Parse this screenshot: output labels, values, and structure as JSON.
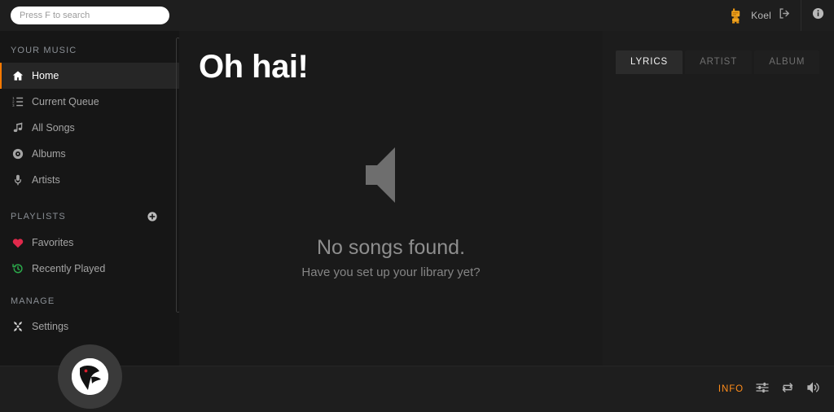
{
  "app": {
    "name": "Koel"
  },
  "topbar": {
    "search": {
      "placeholder": "Press F to search",
      "value": ""
    },
    "username": "Koel",
    "avatar_icon": "user-avatar-icon",
    "logout_icon": "logout-icon",
    "info_icon": "info-circle-icon"
  },
  "sidebar": {
    "sections": [
      {
        "heading": "YOUR MUSIC",
        "has_add_button": false,
        "items": [
          {
            "label": "Home",
            "icon": "home-icon",
            "active": true
          },
          {
            "label": "Current Queue",
            "icon": "queue-list-icon",
            "active": false
          },
          {
            "label": "All Songs",
            "icon": "music-note-icon",
            "active": false
          },
          {
            "label": "Albums",
            "icon": "compact-disc-icon",
            "active": false
          },
          {
            "label": "Artists",
            "icon": "microphone-icon",
            "active": false
          }
        ]
      },
      {
        "heading": "PLAYLISTS",
        "has_add_button": true,
        "add_button_icon": "plus-circle-icon",
        "items": [
          {
            "label": "Favorites",
            "icon": "heart-icon",
            "active": false,
            "color": "#e0294b"
          },
          {
            "label": "Recently Played",
            "icon": "history-icon",
            "active": false,
            "color": "#2ba84a"
          }
        ]
      },
      {
        "heading": "MANAGE",
        "has_add_button": false,
        "items": [
          {
            "label": "Settings",
            "icon": "wrench-icon",
            "active": false
          }
        ]
      }
    ]
  },
  "main": {
    "greeting": "Oh hai!",
    "empty_state": {
      "icon": "volume-speaker-icon",
      "title": "No songs found.",
      "subtitle": "Have you set up your library yet?"
    }
  },
  "right_panel": {
    "tabs": [
      {
        "label": "LYRICS",
        "active": true
      },
      {
        "label": "ARTIST",
        "active": false
      },
      {
        "label": "ALBUM",
        "active": false
      }
    ]
  },
  "footer": {
    "album_art_icon": "koel-logo-icon",
    "info_label": "INFO",
    "equalizer_icon": "equalizer-sliders-icon",
    "repeat_icon": "repeat-icon",
    "volume_icon": "volume-high-icon"
  },
  "colors": {
    "accent": "#ff7a00",
    "info_orange": "#ff8c1a",
    "favorites_red": "#e0294b",
    "recently_played_green": "#2ba84a",
    "sidebar_bg": "#161616",
    "main_bg": "#1a1a1a",
    "panel_bg": "#1c1c1c",
    "topbar_bg": "#1e1e1e"
  }
}
